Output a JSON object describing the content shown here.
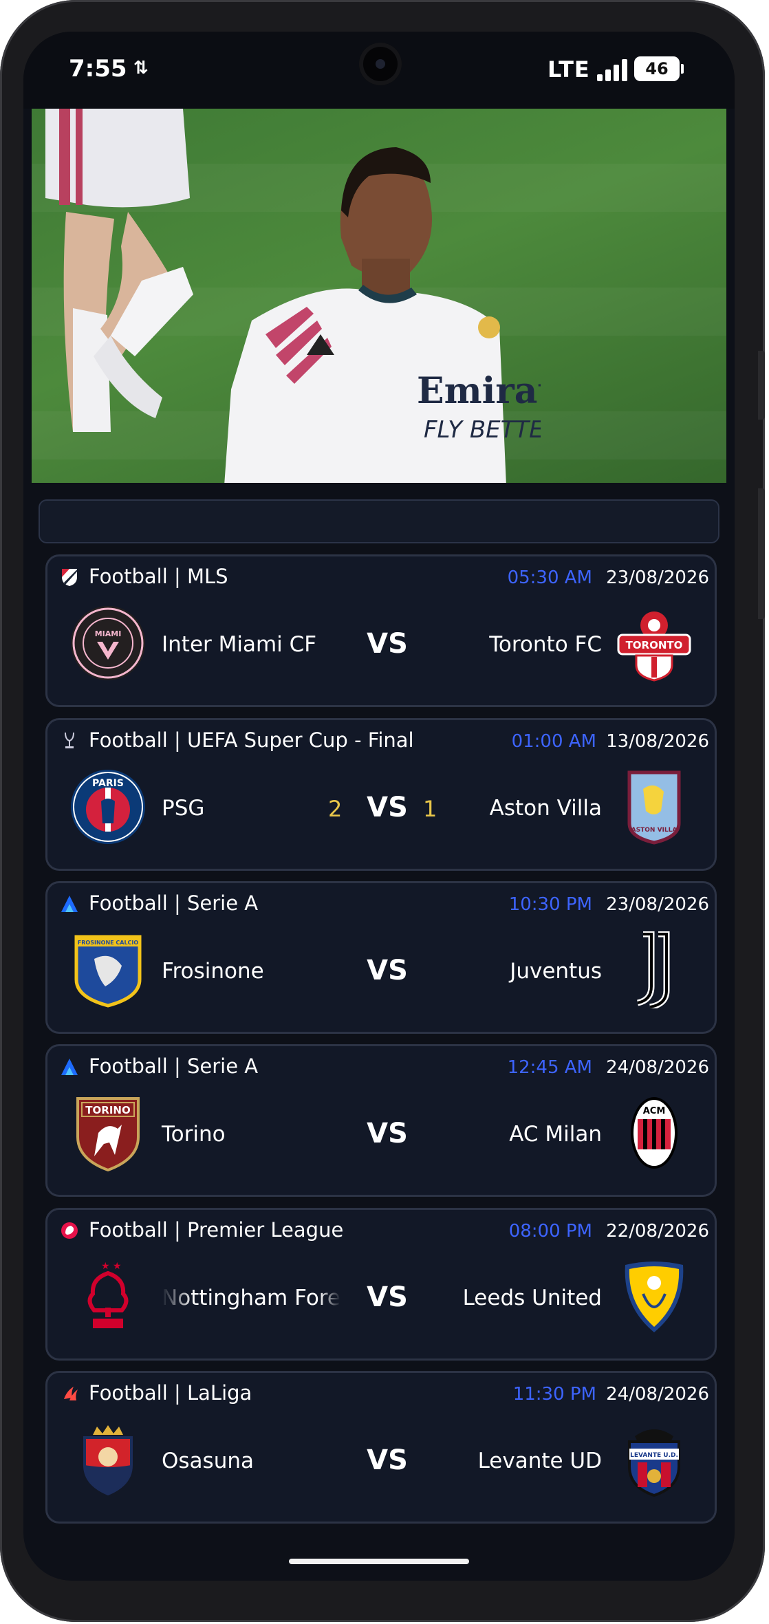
{
  "status_bar": {
    "time": "7:55",
    "network": "LTE",
    "battery": "46"
  },
  "matches": [
    {
      "league": "Football | MLS",
      "time": "05:30 AM",
      "date": "23/08/2026",
      "home": "Inter Miami CF",
      "away": "Toronto FC",
      "vs": "VS",
      "home_score": "",
      "away_score": ""
    },
    {
      "league": "Football | UEFA Super Cup - Final",
      "time": "01:00 AM",
      "date": "13/08/2026",
      "home": "PSG",
      "away": "Aston Villa",
      "vs": "VS",
      "home_score": "2",
      "away_score": "1"
    },
    {
      "league": "Football | Serie A",
      "time": "10:30 PM",
      "date": "23/08/2026",
      "home": "Frosinone",
      "away": "Juventus",
      "vs": "VS",
      "home_score": "",
      "away_score": ""
    },
    {
      "league": "Football | Serie A",
      "time": "12:45 AM",
      "date": "24/08/2026",
      "home": "Torino",
      "away": "AC Milan",
      "vs": "VS",
      "home_score": "",
      "away_score": ""
    },
    {
      "league": "Football | Premier League",
      "time": "08:00 PM",
      "date": "22/08/2026",
      "home": "Nottingham Forest",
      "away": "Leeds United",
      "vs": "VS",
      "home_score": "",
      "away_score": ""
    },
    {
      "league": "Football | LaLiga",
      "time": "11:30 PM",
      "date": "24/08/2026",
      "home": "Osasuna",
      "away": "Levante UD",
      "vs": "VS",
      "home_score": "",
      "away_score": ""
    }
  ],
  "crest_text": {
    "inter_miami": "MIAMI",
    "toronto": "TORONTO",
    "psg": "PARIS",
    "aston_villa": "ASTON VILLA",
    "frosinone": "FROSINONE CALCIO",
    "torino": "TORINO",
    "ac_milan": "ACM",
    "levante": "LEVANTE U.D."
  },
  "colors": {
    "background": "#0d1018",
    "card": "#121827",
    "accent_time": "#3d64ff",
    "score": "#e8c64a"
  }
}
